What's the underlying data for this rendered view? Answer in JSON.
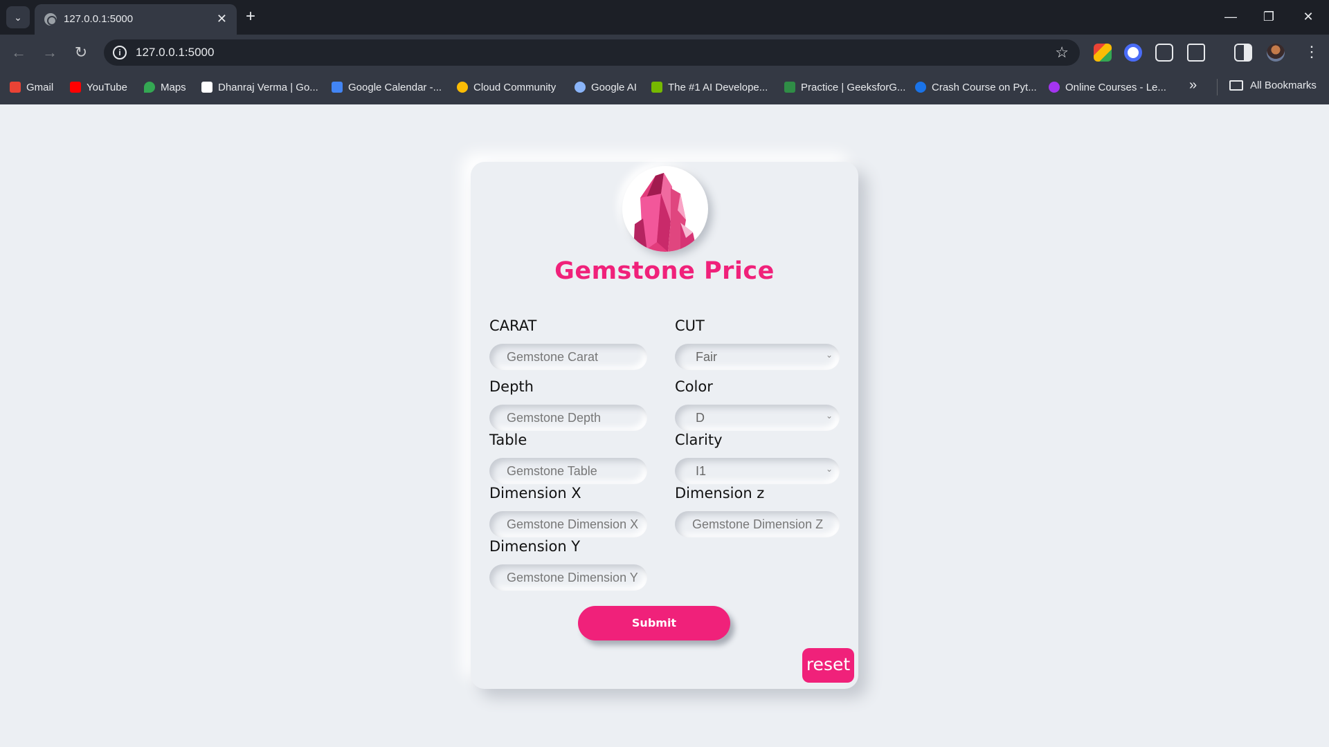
{
  "browser": {
    "tab_title": "127.0.0.1:5000",
    "tab_close": "✕",
    "new_tab": "+",
    "url": "127.0.0.1:5000",
    "window_controls": {
      "minimize": "—",
      "restore": "❐",
      "close": "✕"
    }
  },
  "bookmarks": [
    {
      "label": "Gmail",
      "color": "#ea4335"
    },
    {
      "label": "YouTube",
      "color": "#ff0000"
    },
    {
      "label": "Maps",
      "color": "#34a853"
    },
    {
      "label": "Dhanraj Verma | Go...",
      "color": "#ffffff"
    },
    {
      "label": "Google Calendar -...",
      "color": "#4285f4"
    },
    {
      "label": "Cloud Community",
      "color": "#fbbc05"
    },
    {
      "label": "Google AI",
      "color": "#8ab4f8"
    },
    {
      "label": "The #1 AI Develope...",
      "color": "#76b900"
    },
    {
      "label": "Practice | GeeksforG...",
      "color": "#2f8d46"
    },
    {
      "label": "Crash Course on Pyt...",
      "color": "#1a73e8"
    },
    {
      "label": "Online Courses - Le...",
      "color": "#a435f0"
    }
  ],
  "bookmarks_more": "»",
  "all_bookmarks": "All Bookmarks",
  "form": {
    "title": "Gemstone Price",
    "carat": {
      "label": "CARAT",
      "placeholder": "Gemstone Carat"
    },
    "cut": {
      "label": "CUT",
      "value": "Fair"
    },
    "depth": {
      "label": "Depth",
      "placeholder": "Gemstone Depth"
    },
    "color": {
      "label": "Color",
      "value": "D"
    },
    "table": {
      "label": "Table",
      "placeholder": "Gemstone Table"
    },
    "clarity": {
      "label": "Clarity",
      "value": "I1"
    },
    "dim_x": {
      "label": "Dimension X",
      "placeholder": "Gemstone Dimension X"
    },
    "dim_z": {
      "label": "Dimension z",
      "placeholder": "Gemstone Dimension Z"
    },
    "dim_y": {
      "label": "Dimension Y",
      "placeholder": "Gemstone Dimension Y"
    },
    "submit": "Submit",
    "reset": "reset"
  },
  "colors": {
    "accent": "#f0217a",
    "page_bg": "#eceff3",
    "chrome_bg": "#1f232b"
  }
}
